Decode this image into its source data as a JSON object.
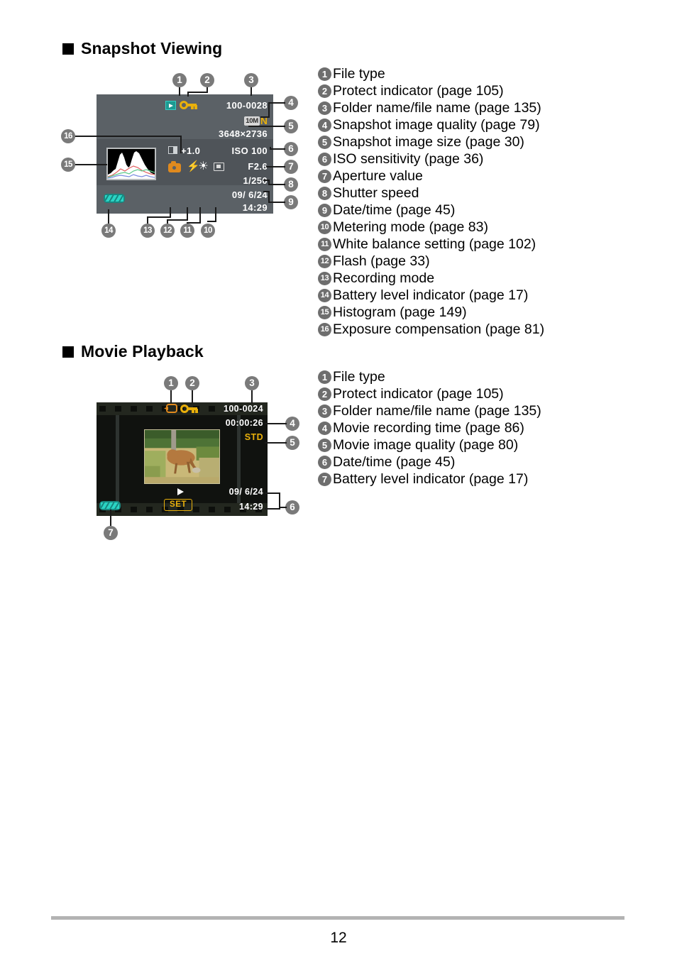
{
  "page": {
    "number": "12"
  },
  "snapshot_section": {
    "heading": "Snapshot Viewing",
    "lcd": {
      "file_number": "100-0028",
      "image_size": "3648×2736",
      "quality_badge": "10M",
      "quality_mark": "N",
      "ev_value": "+1.0",
      "iso": "ISO 100",
      "aperture": "F2.6",
      "shutter": "1/250",
      "date": "09/ 6/24",
      "time": "14:29",
      "icons": {
        "file_type": "play-icon",
        "protect": "key-icon",
        "exposure_comp": "exposure-compensation-icon",
        "recording_mode": "camera-icon",
        "flash": "flash-icon",
        "white_balance": "sun-icon",
        "metering": "metering-icon",
        "battery": "battery-icon",
        "histogram": "histogram-icon"
      }
    },
    "callouts": [
      "1",
      "2",
      "3",
      "4",
      "5",
      "6",
      "7",
      "8",
      "9",
      "10",
      "11",
      "12",
      "13",
      "14",
      "15",
      "16"
    ],
    "legend": [
      {
        "n": "1",
        "label": "File type"
      },
      {
        "n": "2",
        "label": "Protect indicator (page 105)"
      },
      {
        "n": "3",
        "label": "Folder name/file name (page 135)"
      },
      {
        "n": "4",
        "label": "Snapshot image quality (page 79)"
      },
      {
        "n": "5",
        "label": "Snapshot image size (page 30)"
      },
      {
        "n": "6",
        "label": "ISO sensitivity (page 36)"
      },
      {
        "n": "7",
        "label": "Aperture value"
      },
      {
        "n": "8",
        "label": "Shutter speed"
      },
      {
        "n": "9",
        "label": "Date/time (page 45)"
      },
      {
        "n": "10",
        "label": "Metering mode (page 83)"
      },
      {
        "n": "11",
        "label": "White balance setting (page 102)"
      },
      {
        "n": "12",
        "label": "Flash (page 33)"
      },
      {
        "n": "13",
        "label": "Recording mode"
      },
      {
        "n": "14",
        "label": "Battery level indicator (page 17)"
      },
      {
        "n": "15",
        "label": "Histogram (page 149)"
      },
      {
        "n": "16",
        "label": "Exposure compensation (page 81)"
      }
    ]
  },
  "movie_section": {
    "heading": "Movie Playback",
    "lcd": {
      "file_number": "100-0024",
      "recording_time": "00:00:26",
      "quality": "STD",
      "date": "09/ 6/24",
      "time": "14:29",
      "set_label": "SET",
      "icons": {
        "file_type": "movie-icon",
        "protect": "key-icon",
        "play": "play-triangle-icon",
        "battery": "battery-icon"
      }
    },
    "callouts": [
      "1",
      "2",
      "3",
      "4",
      "5",
      "6",
      "7"
    ],
    "legend": [
      {
        "n": "1",
        "label": "File type"
      },
      {
        "n": "2",
        "label": "Protect indicator (page 105)"
      },
      {
        "n": "3",
        "label": "Folder name/file name (page 135)"
      },
      {
        "n": "4",
        "label": "Movie recording time (page 86)"
      },
      {
        "n": "5",
        "label": "Movie image quality (page 80)"
      },
      {
        "n": "6",
        "label": "Date/time (page 45)"
      },
      {
        "n": "7",
        "label": "Battery level indicator (page 17)"
      }
    ]
  },
  "colors": {
    "lcd_background": "#5b6166",
    "movie_background": "#10120f",
    "accent_yellow": "#e9b00b",
    "accent_orange": "#e08a1e",
    "accent_teal": "#2ad4c4",
    "bubble_gray": "#7a7a7a"
  }
}
